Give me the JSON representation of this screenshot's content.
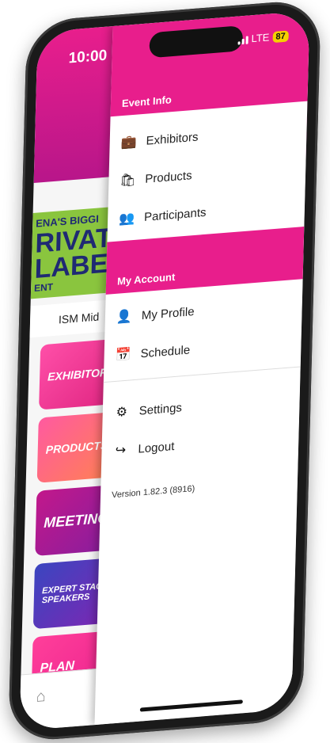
{
  "status": {
    "time": "10:00",
    "network": "LTE",
    "battery": "87"
  },
  "app": {
    "banner": {
      "line1": "ENA'S BIGGI",
      "line2": "RIVAT",
      "line3": "LABE",
      "line4": "ENT"
    },
    "subtitle": "ISM Mid",
    "tiles": [
      "EXHIBITORS",
      "PRODUCTS",
      "MEETING",
      "EXPERT STAGE SPEAKERS",
      "PLAN"
    ],
    "tab_home_icon": "home-icon"
  },
  "drawer": {
    "event_info_header": "Event Info",
    "event_items": [
      {
        "label": "Exhibitors",
        "icon": "briefcase-icon"
      },
      {
        "label": "Products",
        "icon": "shopping-bag-icon"
      },
      {
        "label": "Participants",
        "icon": "users-icon"
      }
    ],
    "account_header": "My Account",
    "account_items": [
      {
        "label": "My Profile",
        "icon": "user-icon"
      },
      {
        "label": "Schedule",
        "icon": "calendar-icon"
      }
    ],
    "other_items": [
      {
        "label": "Settings",
        "icon": "gear-icon"
      },
      {
        "label": "Logout",
        "icon": "logout-icon"
      }
    ],
    "version": "Version 1.82.3 (8916)"
  },
  "colors": {
    "accent": "#e81e8c",
    "banner_green": "#8ac53e"
  }
}
